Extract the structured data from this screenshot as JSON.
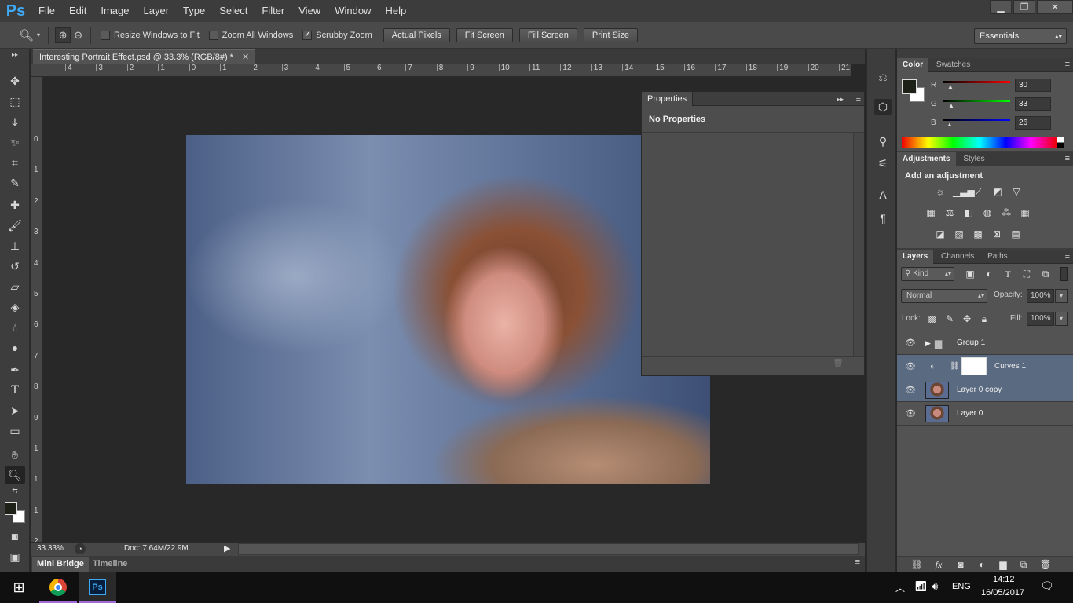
{
  "app": {
    "logo": "Ps"
  },
  "menu": [
    "File",
    "Edit",
    "Image",
    "Layer",
    "Type",
    "Select",
    "Filter",
    "View",
    "Window",
    "Help"
  ],
  "window_controls": {
    "minimize": "▁",
    "restore": "❐",
    "close": "✕"
  },
  "options_bar": {
    "resize_windows": "Resize Windows to Fit",
    "zoom_all": "Zoom All Windows",
    "scrubby": "Scrubby Zoom",
    "scrubby_checked": "✓",
    "actual_pixels": "Actual Pixels",
    "fit_screen": "Fit Screen",
    "fill_screen": "Fill Screen",
    "print_size": "Print Size",
    "workspace": "Essentials"
  },
  "document": {
    "tab_title": "Interesting Portrait Effect.psd @ 33.3% (RGB/8#) *",
    "zoom": "33.33%",
    "doc_size": "Doc: 7.64M/22.9M"
  },
  "ruler_h": [
    "4",
    "3",
    "2",
    "1",
    "0",
    "1",
    "2",
    "3",
    "4",
    "5",
    "6",
    "7",
    "8",
    "9",
    "10",
    "11",
    "12",
    "13",
    "14",
    "15",
    "16",
    "17",
    "18",
    "19",
    "20",
    "21"
  ],
  "ruler_v": [
    "0",
    "1",
    "2",
    "3",
    "4",
    "5",
    "6",
    "7",
    "8",
    "9",
    "1",
    "1",
    "1",
    "2"
  ],
  "properties": {
    "title": "Properties",
    "body": "No Properties"
  },
  "bottom_tabs": {
    "mini_bridge": "Mini Bridge",
    "timeline": "Timeline"
  },
  "color_panel": {
    "tabs": [
      "Color",
      "Swatches"
    ],
    "r_label": "R",
    "g_label": "G",
    "b_label": "B",
    "r": "30",
    "g": "33",
    "b": "26"
  },
  "adjustments": {
    "tabs": [
      "Adjustments",
      "Styles"
    ],
    "title": "Add an adjustment"
  },
  "layers_panel": {
    "tabs": [
      "Layers",
      "Channels",
      "Paths"
    ],
    "kind": "Kind",
    "blend_mode": "Normal",
    "opacity_label": "Opacity:",
    "opacity": "100%",
    "lock_label": "Lock:",
    "fill_label": "Fill:",
    "fill": "100%",
    "layers": [
      {
        "name": "Group 1"
      },
      {
        "name": "Curves 1"
      },
      {
        "name": "Layer 0 copy"
      },
      {
        "name": "Layer 0"
      }
    ]
  },
  "taskbar": {
    "lang": "ENG",
    "time": "14:12",
    "date": "16/05/2017"
  },
  "colors": {
    "ps_blue": "#3fa9f5",
    "panel": "#535353",
    "selected_layer": "#5a6a80"
  }
}
